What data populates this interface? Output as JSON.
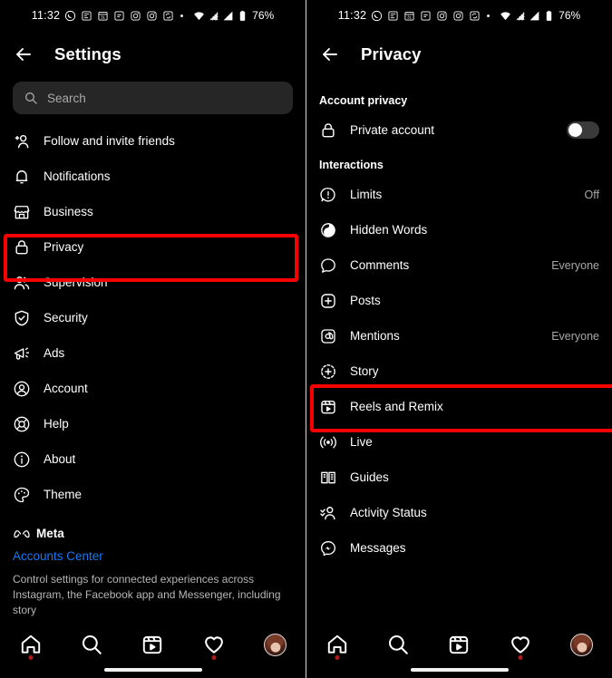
{
  "status_bar": {
    "time": "11:32",
    "battery_percent": "76%",
    "icons": [
      "whatsapp-icon",
      "news-icon",
      "calendar-31-icon",
      "app-icon",
      "instagram-icon",
      "instagram-icon-2",
      "sync-icon",
      "separator-dot",
      "wifi-icon",
      "signal-icon-1",
      "signal-icon-2",
      "battery-icon"
    ]
  },
  "left_panel": {
    "header": {
      "title": "Settings",
      "back_icon": "back-arrow-icon"
    },
    "search": {
      "placeholder": "Search",
      "icon": "search-icon"
    },
    "items": [
      {
        "label": "Follow and invite friends",
        "icon": "add-person-icon",
        "value": ""
      },
      {
        "label": "Notifications",
        "icon": "bell-icon",
        "value": ""
      },
      {
        "label": "Business",
        "icon": "storefront-icon",
        "value": ""
      },
      {
        "label": "Privacy",
        "icon": "lock-icon",
        "value": ""
      },
      {
        "label": "Supervision",
        "icon": "people-icon",
        "value": ""
      },
      {
        "label": "Security",
        "icon": "shield-check-icon",
        "value": ""
      },
      {
        "label": "Ads",
        "icon": "megaphone-icon",
        "value": ""
      },
      {
        "label": "Account",
        "icon": "person-circle-icon",
        "value": ""
      },
      {
        "label": "Help",
        "icon": "lifebuoy-icon",
        "value": ""
      },
      {
        "label": "About",
        "icon": "info-circle-icon",
        "value": ""
      },
      {
        "label": "Theme",
        "icon": "palette-icon",
        "value": ""
      }
    ],
    "meta": {
      "brand": "Meta",
      "brand_icon": "meta-infinity-icon",
      "accounts_center_link": "Accounts Center",
      "description": "Control settings for connected experiences across Instagram, the Facebook app and Messenger, including story"
    },
    "highlight": {
      "target": "Privacy",
      "color": "#f60000"
    }
  },
  "right_panel": {
    "header": {
      "title": "Privacy",
      "back_icon": "back-arrow-icon"
    },
    "sections": [
      {
        "title": "Account privacy",
        "items": [
          {
            "label": "Private account",
            "icon": "lock-icon",
            "control": "toggle",
            "value": "",
            "toggle_on": false
          }
        ]
      },
      {
        "title": "Interactions",
        "items": [
          {
            "label": "Limits",
            "icon": "limits-icon",
            "control": "",
            "value": "Off"
          },
          {
            "label": "Hidden Words",
            "icon": "hidden-words-icon",
            "control": "",
            "value": ""
          },
          {
            "label": "Comments",
            "icon": "comment-icon",
            "control": "",
            "value": "Everyone"
          },
          {
            "label": "Posts",
            "icon": "plus-square-icon",
            "control": "",
            "value": ""
          },
          {
            "label": "Mentions",
            "icon": "at-mention-icon",
            "control": "",
            "value": "Everyone"
          },
          {
            "label": "Story",
            "icon": "story-plus-icon",
            "control": "",
            "value": ""
          },
          {
            "label": "Reels and Remix",
            "icon": "reels-icon",
            "control": "",
            "value": ""
          },
          {
            "label": "Live",
            "icon": "live-broadcast-icon",
            "control": "",
            "value": ""
          },
          {
            "label": "Guides",
            "icon": "guides-book-icon",
            "control": "",
            "value": ""
          },
          {
            "label": "Activity Status",
            "icon": "activity-status-icon",
            "control": "",
            "value": ""
          },
          {
            "label": "Messages",
            "icon": "messenger-icon",
            "control": "",
            "value": ""
          }
        ]
      }
    ],
    "highlight": {
      "target": "Story",
      "color": "#f60000"
    }
  },
  "bottom_nav": {
    "items": [
      {
        "name": "home",
        "icon": "home-icon",
        "badge": true
      },
      {
        "name": "search",
        "icon": "search-icon",
        "badge": false
      },
      {
        "name": "reels",
        "icon": "reels-icon",
        "badge": false
      },
      {
        "name": "activity",
        "icon": "heart-icon",
        "badge": true
      },
      {
        "name": "profile",
        "icon": "avatar-icon",
        "badge": false
      }
    ]
  }
}
